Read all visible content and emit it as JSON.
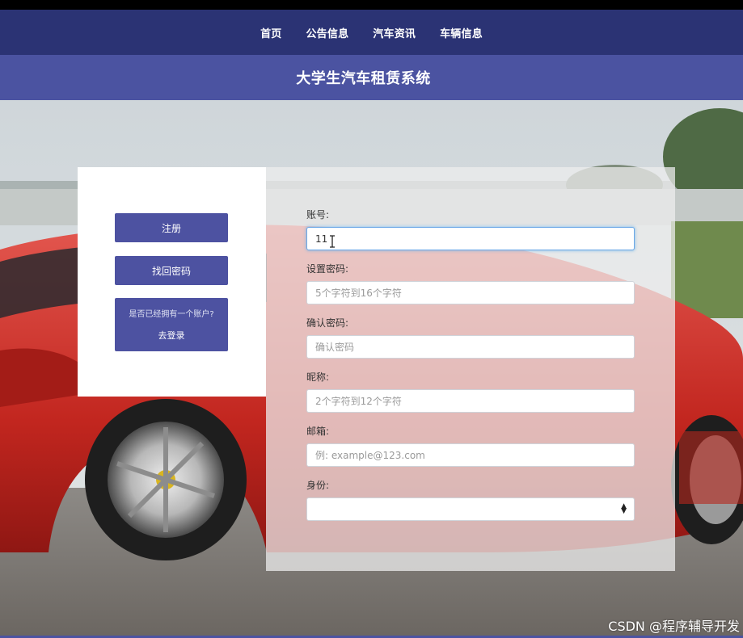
{
  "nav": {
    "items": [
      {
        "label": "首页"
      },
      {
        "label": "公告信息"
      },
      {
        "label": "汽车资讯"
      },
      {
        "label": "车辆信息"
      }
    ]
  },
  "header": {
    "title": "大学生汽车租赁系统"
  },
  "side": {
    "register_label": "注册",
    "find_password_label": "找回密码",
    "login_prompt": "是否已经拥有一个账户?",
    "login_label": "去登录"
  },
  "form": {
    "account": {
      "label": "账号:",
      "value": "11",
      "placeholder": ""
    },
    "password": {
      "label": "设置密码:",
      "value": "",
      "placeholder": "5个字符到16个字符"
    },
    "confirm": {
      "label": "确认密码:",
      "value": "",
      "placeholder": "确认密码"
    },
    "nickname": {
      "label": "昵称:",
      "value": "",
      "placeholder": "2个字符到12个字符"
    },
    "email": {
      "label": "邮箱:",
      "value": "",
      "placeholder": "例: example@123.com"
    },
    "identity": {
      "label": "身份:",
      "selected": ""
    }
  },
  "watermark": "CSDN @程序辅导开发",
  "colors": {
    "nav_bg": "#2b3374",
    "title_bg": "#4b53a1",
    "button_bg": "#4d52a1"
  }
}
